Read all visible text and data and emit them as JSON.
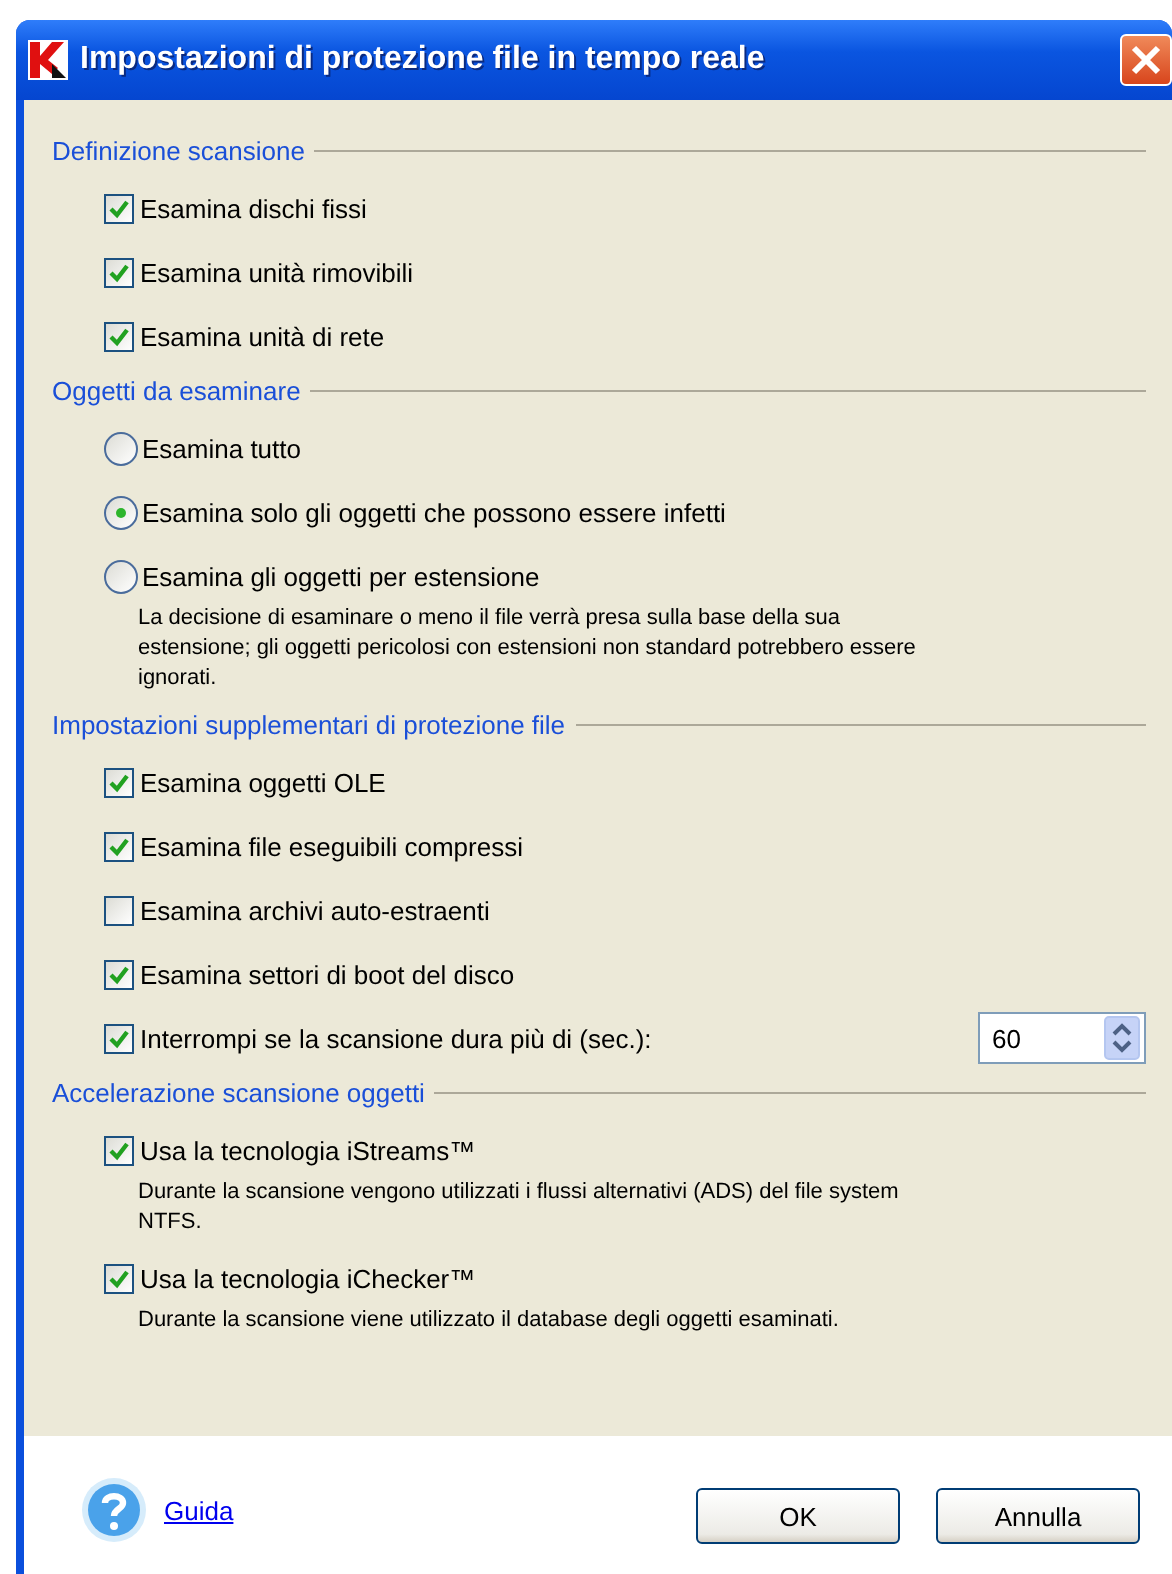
{
  "window": {
    "title": "Impostazioni di protezione file in tempo reale"
  },
  "sections": [
    {
      "title": "Definizione scansione",
      "items": [
        {
          "kind": "checkbox",
          "label": "Esamina dischi fissi",
          "checked": true
        },
        {
          "kind": "checkbox",
          "label": "Esamina unità rimovibili",
          "checked": true
        },
        {
          "kind": "checkbox",
          "label": "Esamina unità di rete",
          "checked": true
        }
      ]
    },
    {
      "title": "Oggetti da esaminare",
      "items": [
        {
          "kind": "radio",
          "label": "Esamina tutto",
          "selected": false
        },
        {
          "kind": "radio",
          "label": "Esamina solo gli oggetti che possono essere infetti",
          "selected": true
        },
        {
          "kind": "radio",
          "label": "Esamina gli oggetti per estensione",
          "selected": false,
          "note": "La decisione di esaminare o meno il file verrà presa sulla base della sua estensione; gli oggetti pericolosi con estensioni non standard potrebbero essere ignorati."
        }
      ]
    },
    {
      "title": "Impostazioni supplementari di protezione file",
      "items": [
        {
          "kind": "checkbox",
          "label": "Esamina oggetti OLE",
          "checked": true
        },
        {
          "kind": "checkbox",
          "label": "Esamina file eseguibili compressi",
          "checked": true
        },
        {
          "kind": "checkbox",
          "label": "Esamina archivi auto-estraenti",
          "checked": false
        },
        {
          "kind": "checkbox",
          "label": "Esamina settori di boot del disco",
          "checked": true
        },
        {
          "kind": "spin",
          "label": "Interrompi se la scansione dura più di (sec.):",
          "checked": true,
          "value": "60"
        }
      ]
    },
    {
      "title": "Accelerazione scansione oggetti",
      "items": [
        {
          "kind": "checkbox",
          "label": "Usa la tecnologia iStreams™",
          "checked": true,
          "note": "Durante la scansione vengono utilizzati i flussi alternativi (ADS) del file system NTFS."
        },
        {
          "kind": "checkbox",
          "label": "Usa la tecnologia iChecker™",
          "checked": true,
          "note": "Durante la scansione viene utilizzato il database degli oggetti esaminati."
        }
      ]
    }
  ],
  "footer": {
    "help_link": "Guida",
    "buttons": [
      "OK",
      "Annulla"
    ]
  }
}
